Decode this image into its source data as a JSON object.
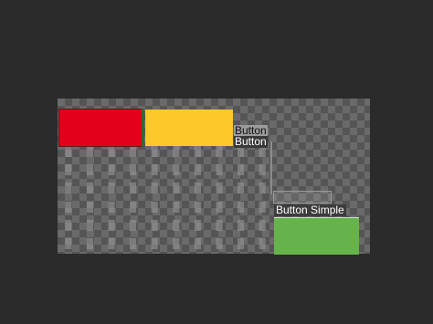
{
  "canvas": {
    "background_pattern": "checkerboard",
    "colors": {
      "red": "#e2001a",
      "yellow": "#fdc829",
      "green": "#66b34b",
      "window_bg": "#2b2b2b"
    }
  },
  "buttons": {
    "button_1_label": "Button",
    "button_2_label": "Button",
    "button_simple_label": "Button Simple"
  }
}
